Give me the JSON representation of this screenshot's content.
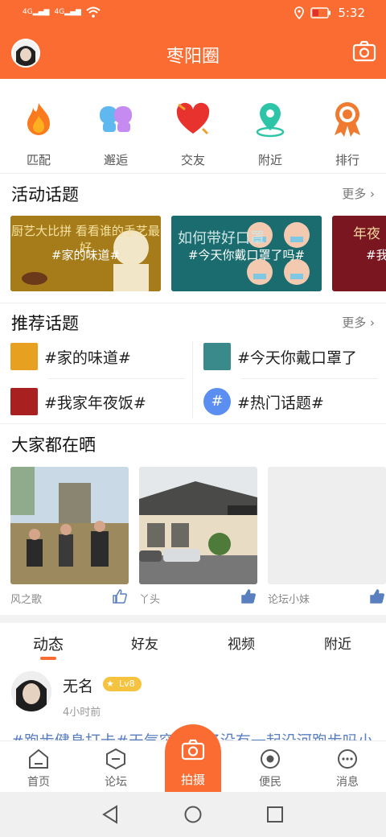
{
  "status_bar": {
    "signal1": "4G",
    "signal2": "4G",
    "time": "5:32"
  },
  "header": {
    "title": "枣阳圈"
  },
  "quick_actions": [
    {
      "label": "匹配",
      "icon": "flame-icon"
    },
    {
      "label": "邂逅",
      "icon": "couple-icon"
    },
    {
      "label": "交友",
      "icon": "heart-icon"
    },
    {
      "label": "附近",
      "icon": "location-pin-icon"
    },
    {
      "label": "排行",
      "icon": "medal-icon"
    }
  ],
  "activity": {
    "title": "活动话题",
    "more": "更多",
    "banners": [
      {
        "title": "#家的味道#",
        "art": "厨艺大比拼 看看谁的手艺最好",
        "color": "#b8860b"
      },
      {
        "title": "#今天你戴口罩了吗#",
        "art": "如何带好口罩",
        "color": "#1b6c6f"
      },
      {
        "title": "#我",
        "art": "年夜",
        "color": "#7a1620"
      }
    ]
  },
  "recommended": {
    "title": "推荐话题",
    "more": "更多",
    "topics": [
      {
        "label": "#家的味道#"
      },
      {
        "label": "#今天你戴口罩了"
      },
      {
        "label": "#我家年夜饭#"
      },
      {
        "label": "#热门话题#"
      }
    ]
  },
  "showcase": {
    "title": "大家都在晒",
    "items": [
      {
        "user": "风之歌"
      },
      {
        "user": "丫头"
      },
      {
        "user": "论坛小妹"
      }
    ]
  },
  "feed_tabs": [
    "动态",
    "好友",
    "视频",
    "附近"
  ],
  "post": {
    "name": "无名",
    "level": "Lv8",
    "time": "4小时前",
    "text": "#跑步健身打卡#天气突然凉了没有一起沿河跑步吗小"
  },
  "bottom_nav": [
    {
      "label": "首页",
      "icon": "home-icon"
    },
    {
      "label": "论坛",
      "icon": "forum-icon"
    },
    {
      "label": "拍摄",
      "icon": "camera-icon"
    },
    {
      "label": "便民",
      "icon": "service-icon"
    },
    {
      "label": "消息",
      "icon": "message-icon"
    }
  ],
  "colors": {
    "accent": "#fa6c32",
    "link": "#5a7fbf"
  }
}
